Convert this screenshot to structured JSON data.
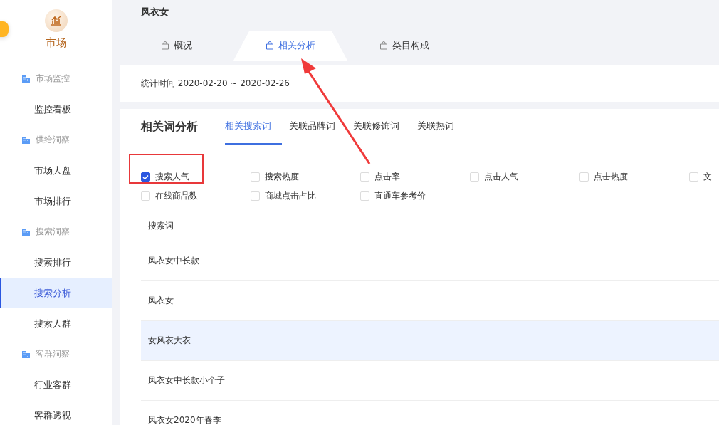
{
  "sidebar": {
    "logo_label": "市场",
    "groups": [
      {
        "title": "市场监控",
        "items": [
          {
            "label": "监控看板",
            "selected": false
          }
        ]
      },
      {
        "title": "供给洞察",
        "items": [
          {
            "label": "市场大盘",
            "selected": false
          },
          {
            "label": "市场排行",
            "selected": false
          }
        ]
      },
      {
        "title": "搜索洞察",
        "items": [
          {
            "label": "搜索排行",
            "selected": false
          },
          {
            "label": "搜索分析",
            "selected": true
          },
          {
            "label": "搜索人群",
            "selected": false
          }
        ]
      },
      {
        "title": "客群洞察",
        "items": [
          {
            "label": "行业客群",
            "selected": false
          },
          {
            "label": "客群透视",
            "selected": false
          }
        ]
      }
    ]
  },
  "header": {
    "title": "风衣女",
    "tabs": [
      {
        "label": "概况",
        "selected": false
      },
      {
        "label": "相关分析",
        "selected": true
      },
      {
        "label": "类目构成",
        "selected": false
      }
    ],
    "period": "统计时间 2020-02-20 ~ 2020-02-26"
  },
  "analysis": {
    "title": "相关词分析",
    "tabs": [
      {
        "label": "相关搜索词",
        "selected": true
      },
      {
        "label": "关联品牌词",
        "selected": false
      },
      {
        "label": "关联修饰词",
        "selected": false
      },
      {
        "label": "关联热词",
        "selected": false
      }
    ],
    "metrics": [
      {
        "label": "搜索人气",
        "checked": true
      },
      {
        "label": "搜索热度",
        "checked": false
      },
      {
        "label": "点击率",
        "checked": false
      },
      {
        "label": "点击人气",
        "checked": false
      },
      {
        "label": "点击热度",
        "checked": false
      },
      {
        "label": "文",
        "checked": false
      },
      {
        "label": "在线商品数",
        "checked": false
      },
      {
        "label": "商城点击占比",
        "checked": false
      },
      {
        "label": "直通车参考价",
        "checked": false
      }
    ],
    "table": {
      "columns": [
        "搜索词"
      ],
      "rows": [
        {
          "cells": [
            "风衣女中长款"
          ],
          "highlighted": false
        },
        {
          "cells": [
            "风衣女"
          ],
          "highlighted": false
        },
        {
          "cells": [
            "女风衣大衣"
          ],
          "highlighted": true
        },
        {
          "cells": [
            "风衣女中长款小个子"
          ],
          "highlighted": false
        },
        {
          "cells": [
            "风衣女2020年春季"
          ],
          "highlighted": false
        }
      ]
    }
  }
}
